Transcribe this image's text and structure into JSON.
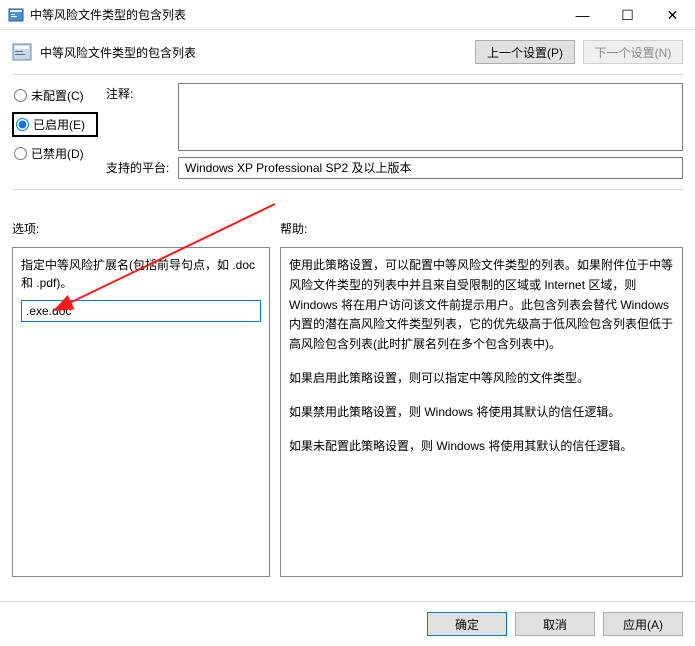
{
  "window": {
    "title": "中等风险文件类型的包含列表",
    "minimize": "—",
    "maximize": "☐",
    "close": "✕"
  },
  "header": {
    "title": "中等风险文件类型的包含列表",
    "prev_btn": "上一个设置(P)",
    "next_btn": "下一个设置(N)"
  },
  "radios": {
    "not_configured": "未配置(C)",
    "enabled": "已启用(E)",
    "disabled": "已禁用(D)"
  },
  "fields": {
    "comment_label": "注释:",
    "comment_value": "",
    "platform_label": "支持的平台:",
    "platform_value": "Windows XP Professional SP2 及以上版本"
  },
  "options": {
    "label": "选项:",
    "description": "指定中等风险扩展名(包括前导句点，如 .doc 和 .pdf)。",
    "ext_value": ".exe.doc"
  },
  "help": {
    "label": "帮助:",
    "p1": "使用此策略设置，可以配置中等风险文件类型的列表。如果附件位于中等风险文件类型的列表中并且来自受限制的区域或 Internet 区域，则 Windows 将在用户访问该文件前提示用户。此包含列表会替代 Windows 内置的潜在高风险文件类型列表，它的优先级高于低风险包含列表但低于高风险包含列表(此时扩展名列在多个包含列表中)。",
    "p2": "如果启用此策略设置，则可以指定中等风险的文件类型。",
    "p3": "如果禁用此策略设置，则 Windows 将使用其默认的信任逻辑。",
    "p4": "如果未配置此策略设置，则 Windows 将使用其默认的信任逻辑。"
  },
  "footer": {
    "ok": "确定",
    "cancel": "取消",
    "apply": "应用(A)"
  }
}
